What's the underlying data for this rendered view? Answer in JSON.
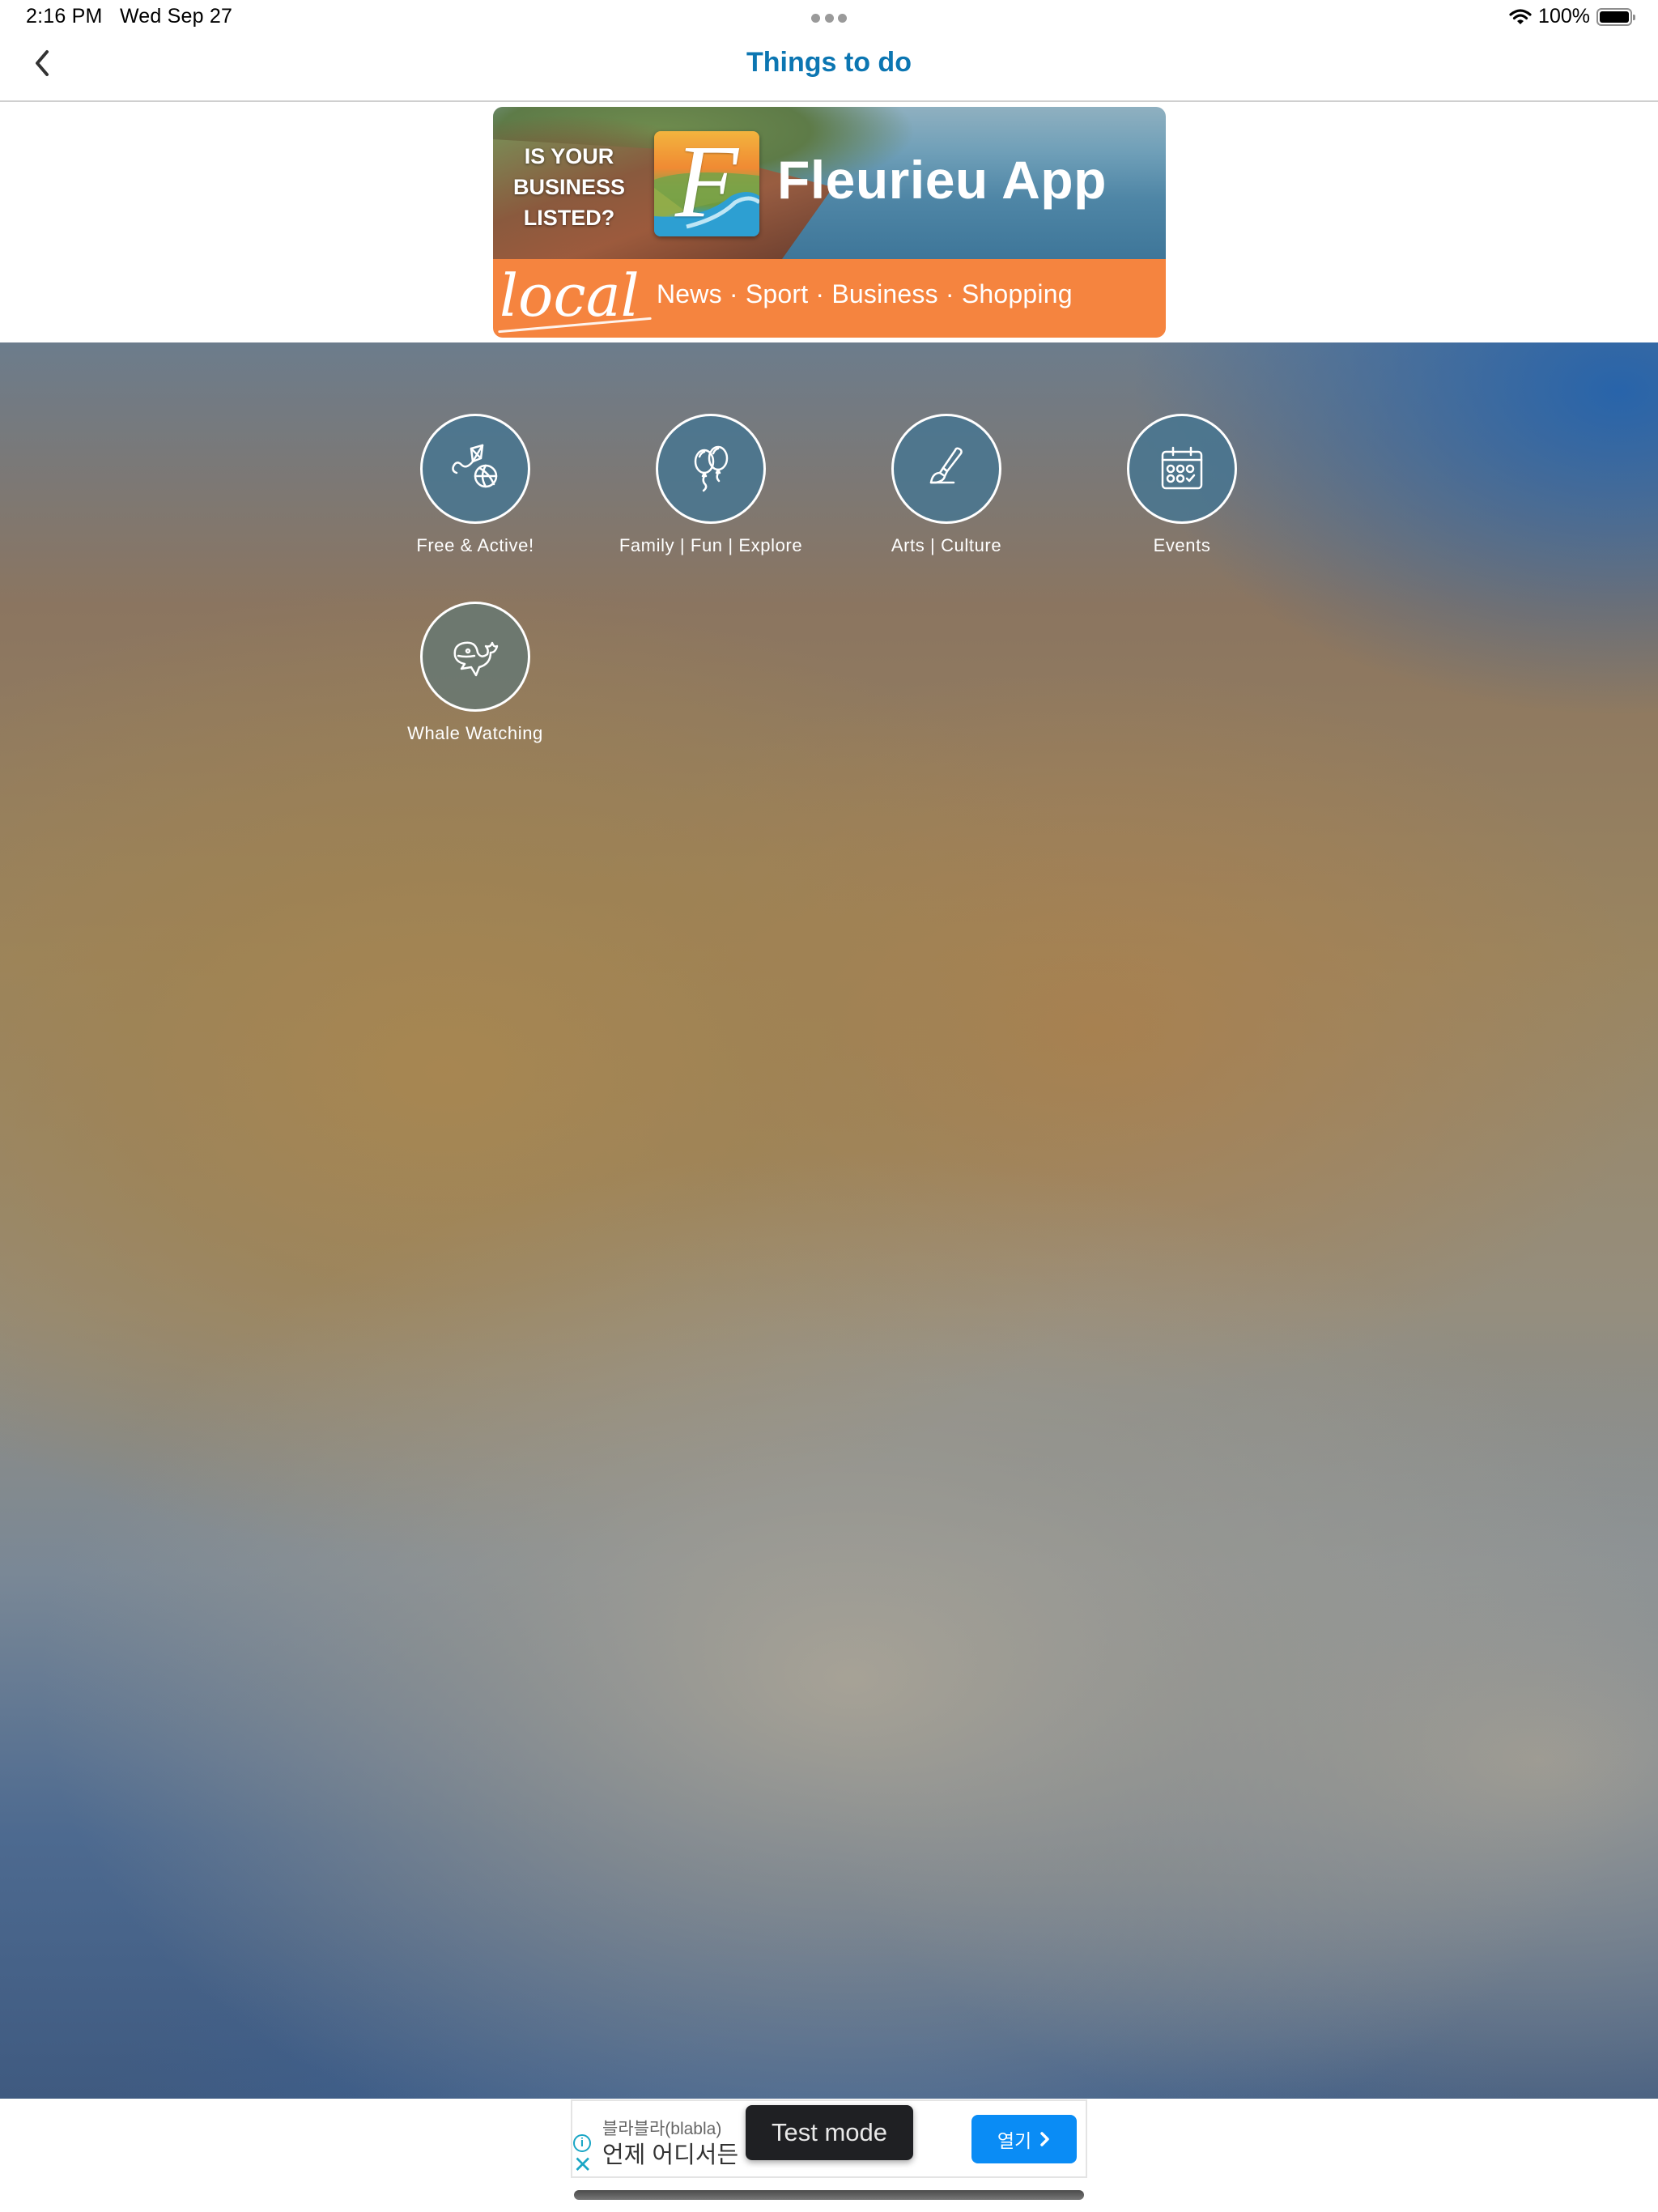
{
  "status_bar": {
    "time": "2:16 PM",
    "date": "Wed Sep 27",
    "battery": "100%",
    "icons": [
      "wifi-icon",
      "battery-icon"
    ]
  },
  "nav": {
    "back_icon": "chevron-left-icon",
    "title": "Things to do",
    "title_color": "#0c76b2"
  },
  "banner": {
    "question_line1": "IS YOUR",
    "question_line2": "BUSINESS",
    "question_line3": "LISTED?",
    "logo_letter": "F",
    "app_name": "Fleurieu App",
    "script_word": "local",
    "tags": "News · Sport · Business · Shopping",
    "accent_color": "#f5843f"
  },
  "categories": [
    {
      "label": "Free & Active!",
      "icon": "kite-ball-icon"
    },
    {
      "label": "Family | Fun | Explore",
      "icon": "balloons-icon"
    },
    {
      "label": "Arts | Culture",
      "icon": "paintbrush-icon"
    },
    {
      "label": "Events",
      "icon": "calendar-icon"
    },
    {
      "label": "Whale Watching",
      "icon": "whale-icon"
    }
  ],
  "ad": {
    "advertiser": "블라블라(blabla)",
    "headline": "언제 어디서든 앙",
    "test_mode": "Test mode",
    "open_button": "열기",
    "open_color": "#0a8cf5"
  }
}
